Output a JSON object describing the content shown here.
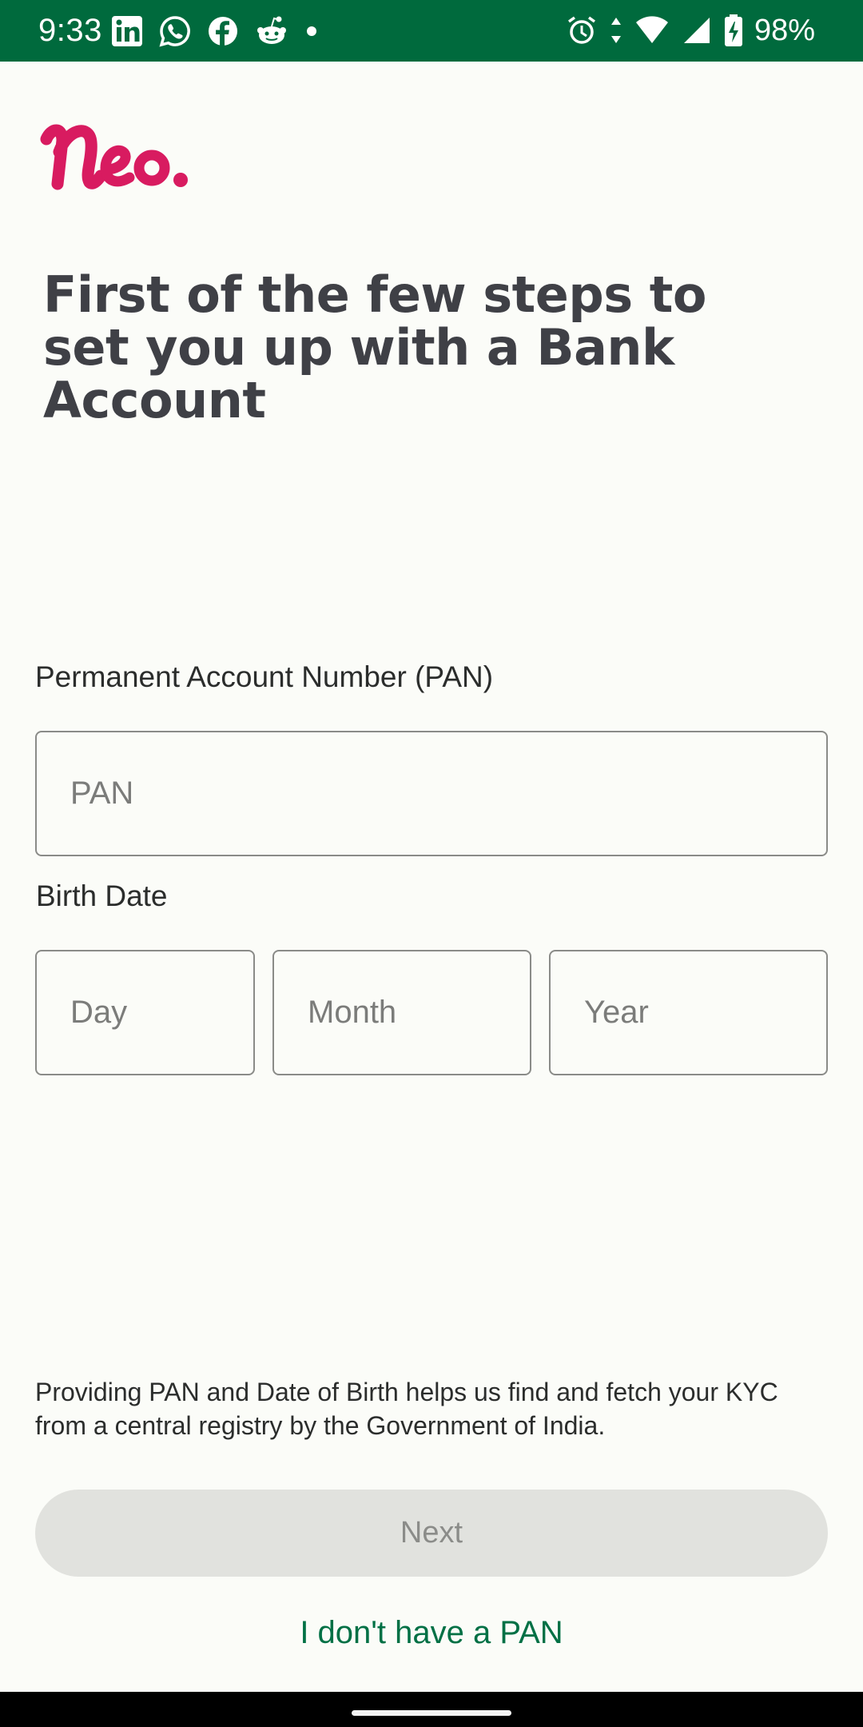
{
  "status_bar": {
    "time": "9:33",
    "battery": "98%",
    "notification_icons": [
      "linkedin-icon",
      "whatsapp-icon",
      "facebook-icon",
      "reddit-icon",
      "dot-icon"
    ],
    "system_icons": [
      "alarm-icon",
      "data-arrows-icon",
      "wifi-icon",
      "signal-icon",
      "battery-charging-icon"
    ],
    "background_color": "#006a3d"
  },
  "app": {
    "logo_text": "Neo.",
    "brand_color": "#d81b60"
  },
  "page": {
    "title": "First of the few steps to set you up with a Bank Account"
  },
  "form": {
    "pan_label": "Permanent Account Number (PAN)",
    "pan_placeholder": "PAN",
    "pan_value": "",
    "birth_date_label": "Birth Date",
    "day_placeholder": "Day",
    "month_placeholder": "Month",
    "year_placeholder": "Year"
  },
  "info_text": "Providing PAN and Date of Birth helps us find and fetch your KYC from a central registry by the Government of India.",
  "actions": {
    "next_label": "Next",
    "no_pan_label": "I don't have a PAN",
    "link_color": "#007045"
  }
}
